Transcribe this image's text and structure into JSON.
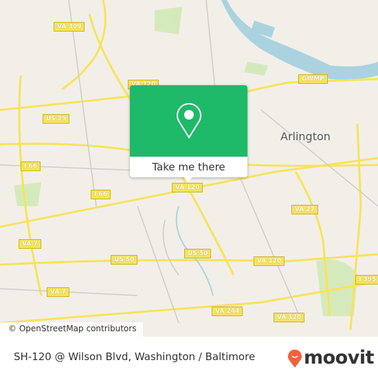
{
  "map": {
    "city_label": "Arlington",
    "shields": [
      "VA 309",
      "VA 120",
      "US 29",
      "I 66",
      "I 66",
      "VA 120",
      "GWMP",
      "VA 27",
      "VA 7",
      "VA 7",
      "US 50",
      "US 50",
      "VA 120",
      "VA 244",
      "VA 120",
      "I 395"
    ],
    "attribution": "© OpenStreetMap contributors",
    "colors": {
      "land": "#f2efe9",
      "road": "#f7e35a",
      "water": "#aad3df",
      "park": "#cde8b0"
    }
  },
  "popup": {
    "button_label": "Take me there",
    "icon": "map-pin-icon",
    "color": "#1fb96a"
  },
  "footer": {
    "title": "SH-120 @ Wilson Blvd, Washington / Baltimore",
    "logo_text": "moovit",
    "logo_color": "#f0643c"
  }
}
